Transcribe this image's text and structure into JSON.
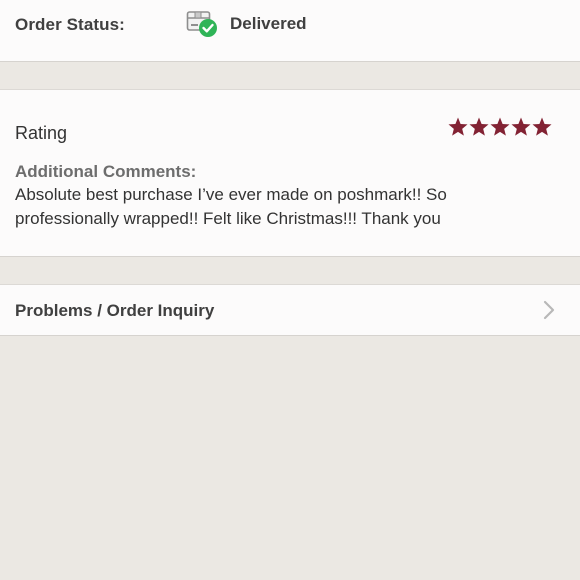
{
  "order_status": {
    "label": "Order Status:",
    "value": "Delivered",
    "icon": "package-delivered-icon",
    "check_color": "#2fb457"
  },
  "rating": {
    "label": "Rating",
    "stars": 5,
    "max_stars": 5,
    "star_color": "#822233",
    "comments_label": "Additional Comments:",
    "comments_text": "Absolute best purchase I’ve ever made on poshmark!! So professionally wrapped!! Felt like Christmas!!! Thank you"
  },
  "problems": {
    "label": "Problems / Order Inquiry",
    "icon": "chevron-right-icon"
  }
}
